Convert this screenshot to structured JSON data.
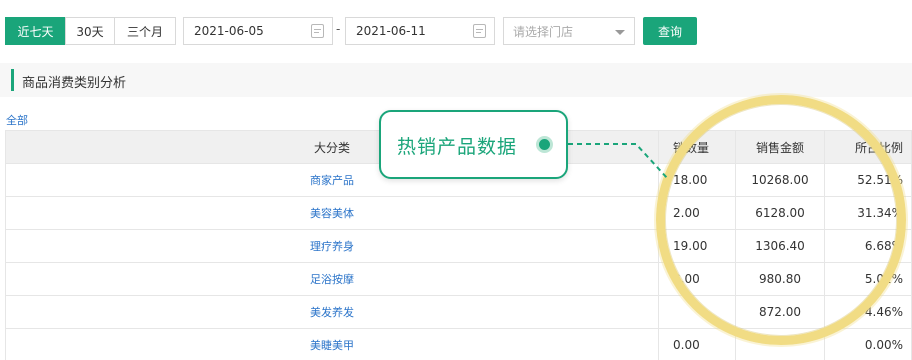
{
  "toolbar": {
    "range_buttons": [
      "近七天",
      "30天",
      "三个月"
    ],
    "start_date": "2021-06-05",
    "separator": "-",
    "end_date": "2021-06-11",
    "store_placeholder": "请选择门店",
    "query_label": "查询"
  },
  "section": {
    "title": "商品消费类别分析"
  },
  "filter": {
    "all_label": "全部"
  },
  "table": {
    "headers": {
      "category": "大分类",
      "qty": "销数量",
      "amount": "销售金额",
      "pct": "所占比例"
    },
    "rows": [
      {
        "category": "商家产品",
        "qty": "18.00",
        "amount": "10268.00",
        "pct": "52.51%"
      },
      {
        "category": "美容美体",
        "qty": "2.00",
        "amount": "6128.00",
        "pct": "31.34%"
      },
      {
        "category": "理疗养身",
        "qty": "19.00",
        "amount": "1306.40",
        "pct": "6.68%"
      },
      {
        "category": "足浴按摩",
        "qty": "3.00",
        "amount": "980.80",
        "pct": "5.02%"
      },
      {
        "category": "美发养发",
        "qty": "",
        "amount": "872.00",
        "pct": "4.46%"
      },
      {
        "category": "美睫美甲",
        "qty": "0.00",
        "amount": "",
        "pct": "0.00%"
      }
    ]
  },
  "callout": {
    "text": "热销产品数据"
  },
  "colors": {
    "accent": "#1aa57a",
    "link": "#2b74c9",
    "magnifier_ring": "#f1dc84"
  }
}
